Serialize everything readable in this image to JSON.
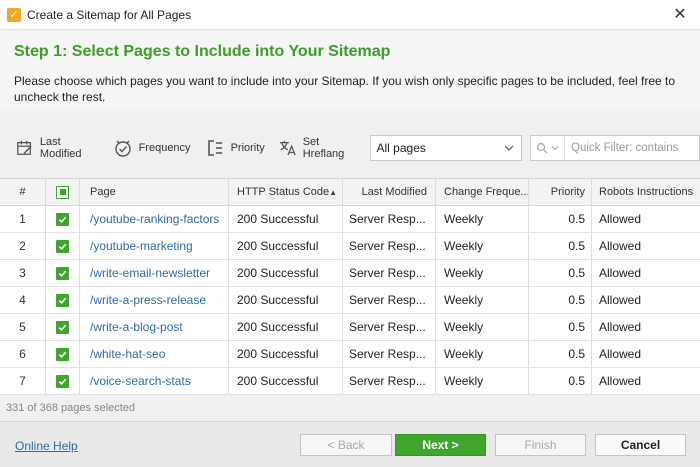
{
  "window": {
    "title": "Create a Sitemap for All Pages",
    "close_glyph": "✕",
    "app_icon_glyph": "✓"
  },
  "header": {
    "title": "Step 1: Select Pages to Include into Your Sitemap",
    "description": "Please choose which pages you want to include into your Sitemap. If you wish only specific pages to be included, feel free to uncheck the rest."
  },
  "toolbar": {
    "last_modified_label": "Last Modified",
    "frequency_label": "Frequency",
    "priority_label": "Priority",
    "hreflang_label": "Set Hreflang",
    "pages_select_value": "All pages",
    "filter_placeholder": "Quick Filter: contains"
  },
  "table": {
    "headers": {
      "num": "#",
      "page": "Page",
      "status": "HTTP Status Code",
      "modified": "Last Modified",
      "frequency": "Change Freque...",
      "priority": "Priority",
      "robots": "Robots Instructions"
    },
    "sort_glyph": "▲",
    "rows": [
      {
        "num": "1",
        "page": "/youtube-ranking-factors",
        "status": "200 Successful",
        "modified": "Server Resp...",
        "frequency": "Weekly",
        "priority": "0.5",
        "robots": "Allowed",
        "checked": true
      },
      {
        "num": "2",
        "page": "/youtube-marketing",
        "status": "200 Successful",
        "modified": "Server Resp...",
        "frequency": "Weekly",
        "priority": "0.5",
        "robots": "Allowed",
        "checked": true
      },
      {
        "num": "3",
        "page": "/write-email-newsletter",
        "status": "200 Successful",
        "modified": "Server Resp...",
        "frequency": "Weekly",
        "priority": "0.5",
        "robots": "Allowed",
        "checked": true
      },
      {
        "num": "4",
        "page": "/write-a-press-release",
        "status": "200 Successful",
        "modified": "Server Resp...",
        "frequency": "Weekly",
        "priority": "0.5",
        "robots": "Allowed",
        "checked": true
      },
      {
        "num": "5",
        "page": "/write-a-blog-post",
        "status": "200 Successful",
        "modified": "Server Resp...",
        "frequency": "Weekly",
        "priority": "0.5",
        "robots": "Allowed",
        "checked": true
      },
      {
        "num": "6",
        "page": "/white-hat-seo",
        "status": "200 Successful",
        "modified": "Server Resp...",
        "frequency": "Weekly",
        "priority": "0.5",
        "robots": "Allowed",
        "checked": true
      },
      {
        "num": "7",
        "page": "/voice-search-stats",
        "status": "200 Successful",
        "modified": "Server Resp...",
        "frequency": "Weekly",
        "priority": "0.5",
        "robots": "Allowed",
        "checked": true
      }
    ]
  },
  "status": {
    "selection_text": "331 of 368 pages selected"
  },
  "footer": {
    "help_label": "Online Help",
    "back_label": "< Back",
    "next_label": "Next >",
    "finish_label": "Finish",
    "cancel_label": "Cancel"
  },
  "colors": {
    "accent_green": "#3fa52c",
    "title_green": "#3d9e2a",
    "link_blue": "#2f6aa8"
  }
}
